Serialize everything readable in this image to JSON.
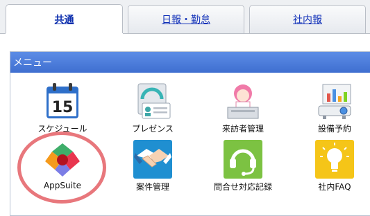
{
  "tabs": [
    {
      "label": "共通",
      "active": true
    },
    {
      "label": "日報・勤怠",
      "active": false
    },
    {
      "label": "社内報",
      "active": false
    }
  ],
  "panel": {
    "title": "メニュー"
  },
  "menu": [
    {
      "label": "スケジュール",
      "icon": "calendar-icon",
      "calendar_day": "15"
    },
    {
      "label": "プレゼンス",
      "icon": "presence-card-icon"
    },
    {
      "label": "来訪者管理",
      "icon": "receptionist-icon"
    },
    {
      "label": "設備予約",
      "icon": "projector-icon"
    },
    {
      "label": "AppSuite",
      "icon": "appsuite-icon",
      "highlighted": true
    },
    {
      "label": "案件管理",
      "icon": "handshake-icon"
    },
    {
      "label": "問合せ対応記録",
      "icon": "headset-icon"
    },
    {
      "label": "社内FAQ",
      "icon": "lightbulb-icon"
    }
  ],
  "colors": {
    "accent": "#3f6fd0",
    "link": "#1030b8",
    "highlight_ring": "#e8777c"
  }
}
